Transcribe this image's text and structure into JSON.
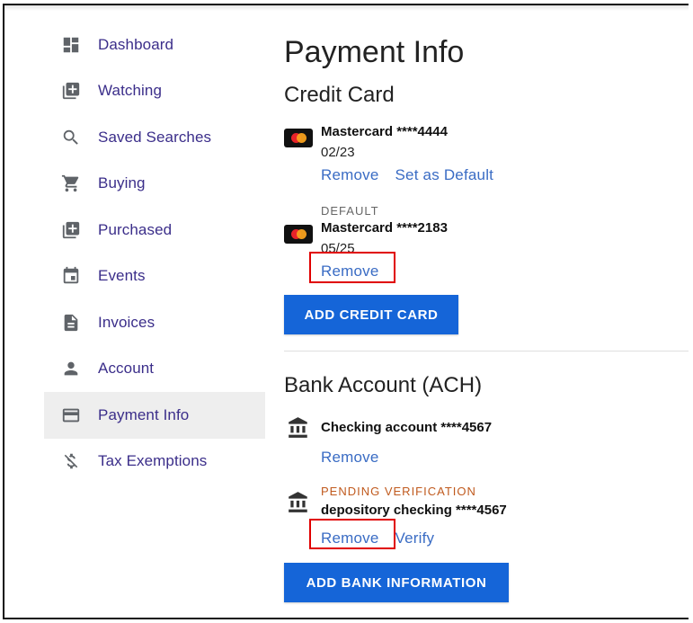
{
  "sidebar": {
    "items": [
      {
        "label": "Dashboard",
        "icon": "dashboard-icon"
      },
      {
        "label": "Watching",
        "icon": "add-box-icon"
      },
      {
        "label": "Saved Searches",
        "icon": "search-icon"
      },
      {
        "label": "Buying",
        "icon": "cart-icon"
      },
      {
        "label": "Purchased",
        "icon": "add-box-icon"
      },
      {
        "label": "Events",
        "icon": "calendar-icon"
      },
      {
        "label": "Invoices",
        "icon": "document-icon"
      },
      {
        "label": "Account",
        "icon": "person-icon"
      },
      {
        "label": "Payment Info",
        "icon": "credit-card-icon",
        "active": true
      },
      {
        "label": "Tax Exemptions",
        "icon": "money-off-icon"
      }
    ]
  },
  "main": {
    "title": "Payment Info",
    "credit_card": {
      "heading": "Credit Card",
      "cards": [
        {
          "name": "Mastercard ****4444",
          "exp": "02/23",
          "remove_label": "Remove",
          "default_label": "Set as Default"
        },
        {
          "badge": "DEFAULT",
          "name": "Mastercard ****2183",
          "exp": "05/25",
          "remove_label": "Remove"
        }
      ],
      "add_button": "ADD CREDIT CARD"
    },
    "bank": {
      "heading": "Bank Account (ACH)",
      "accounts": [
        {
          "name": "Checking account ****4567",
          "remove_label": "Remove"
        },
        {
          "badge": "PENDING VERIFICATION",
          "name": "depository checking ****4567",
          "remove_label": "Remove",
          "verify_label": "Verify"
        }
      ],
      "add_button": "ADD BANK INFORMATION"
    }
  },
  "colors": {
    "accent": "#1565d8",
    "link": "#3a6cc4",
    "nav_text": "#3b2e8a",
    "pending": "#c05a1e",
    "highlight": "#e00000"
  }
}
